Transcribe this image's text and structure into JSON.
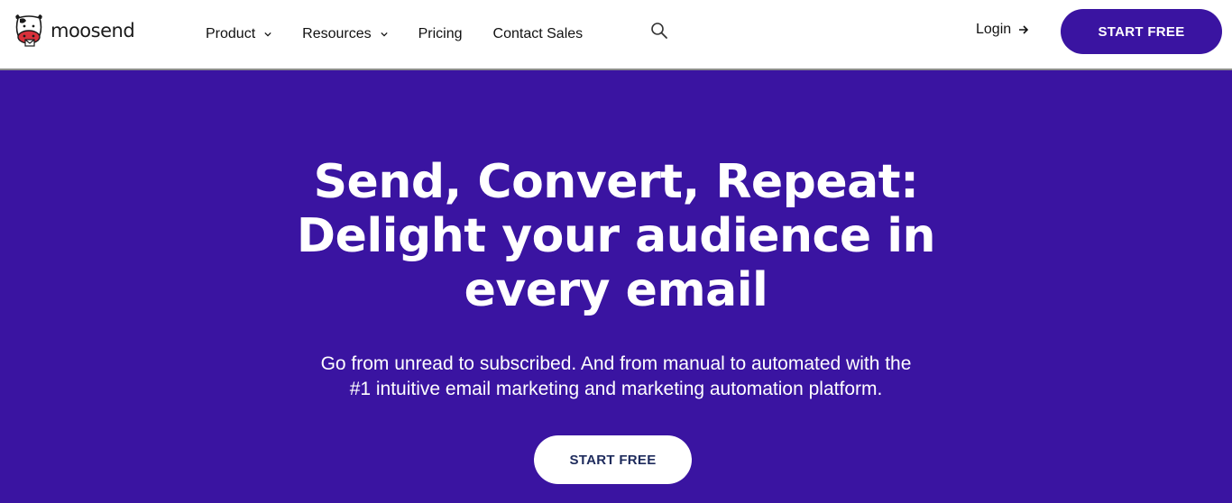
{
  "header": {
    "logo_text": "moosend",
    "nav": [
      {
        "label": "Product",
        "has_dropdown": true
      },
      {
        "label": "Resources",
        "has_dropdown": true
      },
      {
        "label": "Pricing",
        "has_dropdown": false
      },
      {
        "label": "Contact Sales",
        "has_dropdown": false
      }
    ],
    "search_icon": "search-icon",
    "login_label": "Login",
    "start_free_label": "START FREE"
  },
  "hero": {
    "title_lines": [
      "Send, Convert, Repeat:",
      "Delight your audience in",
      "every email"
    ],
    "subtitle_lines": [
      "Go from unread to subscribed. And from manual to automated with the",
      "#1 intuitive email marketing and marketing automation platform."
    ],
    "cta_label": "START FREE"
  },
  "colors": {
    "brand_purple": "#3a14a1",
    "header_bg": "#ffffff",
    "cta_text": "#1e2b5c",
    "cow_red": "#d9313b"
  }
}
